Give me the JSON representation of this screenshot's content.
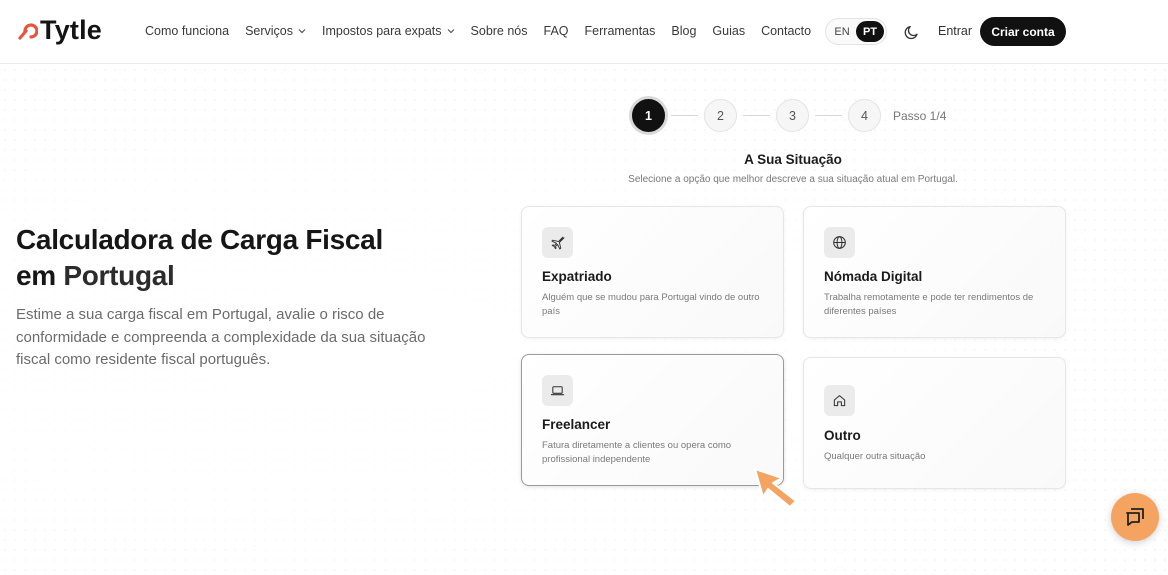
{
  "brand": {
    "name": "Tytle",
    "accent": "#e8553f"
  },
  "nav": {
    "items": [
      {
        "label": "Como funciona",
        "dropdown": false
      },
      {
        "label": "Serviços",
        "dropdown": true
      },
      {
        "label": "Impostos para expats",
        "dropdown": true
      },
      {
        "label": "Sobre nós",
        "dropdown": false
      },
      {
        "label": "FAQ",
        "dropdown": false
      },
      {
        "label": "Ferramentas",
        "dropdown": false
      },
      {
        "label": "Blog",
        "dropdown": false
      },
      {
        "label": "Guias",
        "dropdown": false
      },
      {
        "label": "Contacto",
        "dropdown": false
      }
    ],
    "lang_en": "EN",
    "lang_pt": "PT",
    "active_lang": "PT",
    "theme_icon": "moon-icon",
    "login": "Entrar",
    "signup": "Criar conta"
  },
  "hero": {
    "title_line1": "Calculadora de Carga Fiscal",
    "title_line2_a": "em ",
    "title_line2_b": "Portugal",
    "description": "Estime a sua carga fiscal em Portugal, avalie o risco de conformidade e compreenda a complexidade da sua situação fiscal como residente fiscal português."
  },
  "stepper": {
    "steps": [
      "1",
      "2",
      "3",
      "4"
    ],
    "current": 1,
    "label": "Passo 1/4"
  },
  "section": {
    "title": "A Sua Situação",
    "subtitle": "Selecione a opção que melhor descreve a sua situação atual em Portugal."
  },
  "options": [
    {
      "icon": "plane-icon",
      "title": "Expatriado",
      "description": "Alguém que se mudou para Portugal vindo de outro país",
      "selected": false
    },
    {
      "icon": "globe-icon",
      "title": "Nómada Digital",
      "description": "Trabalha remotamente e pode ter rendimentos de diferentes países",
      "selected": false
    },
    {
      "icon": "laptop-icon",
      "title": "Freelancer",
      "description": "Fatura diretamente a clientes ou opera como profissional independente",
      "selected": true
    },
    {
      "icon": "home-icon",
      "title": "Outro",
      "description": "Qualquer outra situação",
      "selected": false
    }
  ],
  "chat": {
    "icon": "chat-icon",
    "color": "#f4a460"
  }
}
